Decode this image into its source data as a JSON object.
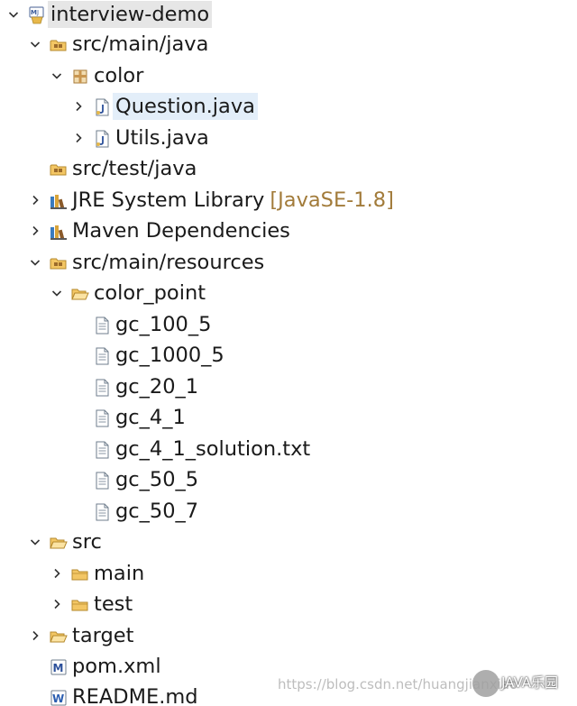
{
  "tree": [
    {
      "label": "interview-demo",
      "icon": "maven-project-icon",
      "chevron": "down",
      "selected": "gray"
    },
    {
      "label": "src/main/java",
      "icon": "source-folder-icon",
      "chevron": "down"
    },
    {
      "label": "color",
      "icon": "package-icon",
      "chevron": "down"
    },
    {
      "label": "Question.java",
      "icon": "java-file-icon",
      "chevron": "right",
      "selected": "blue"
    },
    {
      "label": "Utils.java",
      "icon": "java-file-icon",
      "chevron": "right"
    },
    {
      "label": "src/test/java",
      "icon": "source-folder-icon",
      "chevron": "none"
    },
    {
      "label": "JRE System Library",
      "decoration": "[JavaSE-1.8]",
      "icon": "library-icon",
      "chevron": "right"
    },
    {
      "label": "Maven Dependencies",
      "icon": "library-icon",
      "chevron": "right"
    },
    {
      "label": "src/main/resources",
      "icon": "source-folder-icon",
      "chevron": "down"
    },
    {
      "label": "color_point",
      "icon": "open-folder-icon",
      "chevron": "down"
    },
    {
      "label": "gc_100_5",
      "icon": "text-file-icon",
      "chevron": "none"
    },
    {
      "label": "gc_1000_5",
      "icon": "text-file-icon",
      "chevron": "none"
    },
    {
      "label": "gc_20_1",
      "icon": "text-file-icon",
      "chevron": "none"
    },
    {
      "label": "gc_4_1",
      "icon": "text-file-icon",
      "chevron": "none"
    },
    {
      "label": "gc_4_1_solution.txt",
      "icon": "text-file-icon",
      "chevron": "none"
    },
    {
      "label": "gc_50_5",
      "icon": "text-file-icon",
      "chevron": "none"
    },
    {
      "label": "gc_50_7",
      "icon": "text-file-icon",
      "chevron": "none"
    },
    {
      "label": "src",
      "icon": "open-folder-icon",
      "chevron": "down"
    },
    {
      "label": "main",
      "icon": "folder-icon",
      "chevron": "right"
    },
    {
      "label": "test",
      "icon": "folder-icon",
      "chevron": "right"
    },
    {
      "label": "target",
      "icon": "open-folder-icon",
      "chevron": "right"
    },
    {
      "label": "pom.xml",
      "icon": "maven-pom-icon",
      "chevron": "none"
    },
    {
      "label": "README.md",
      "icon": "word-file-icon",
      "chevron": "none"
    }
  ],
  "watermark": {
    "url": "https://blog.csdn.net/huangjianxiao",
    "brand": "JAVA乐园"
  },
  "colors": {
    "selection_gray": "#e6e6e6",
    "selection_blue": "#e3eef9",
    "decoration": "#a27b3a",
    "folder": "#e8b84a"
  }
}
